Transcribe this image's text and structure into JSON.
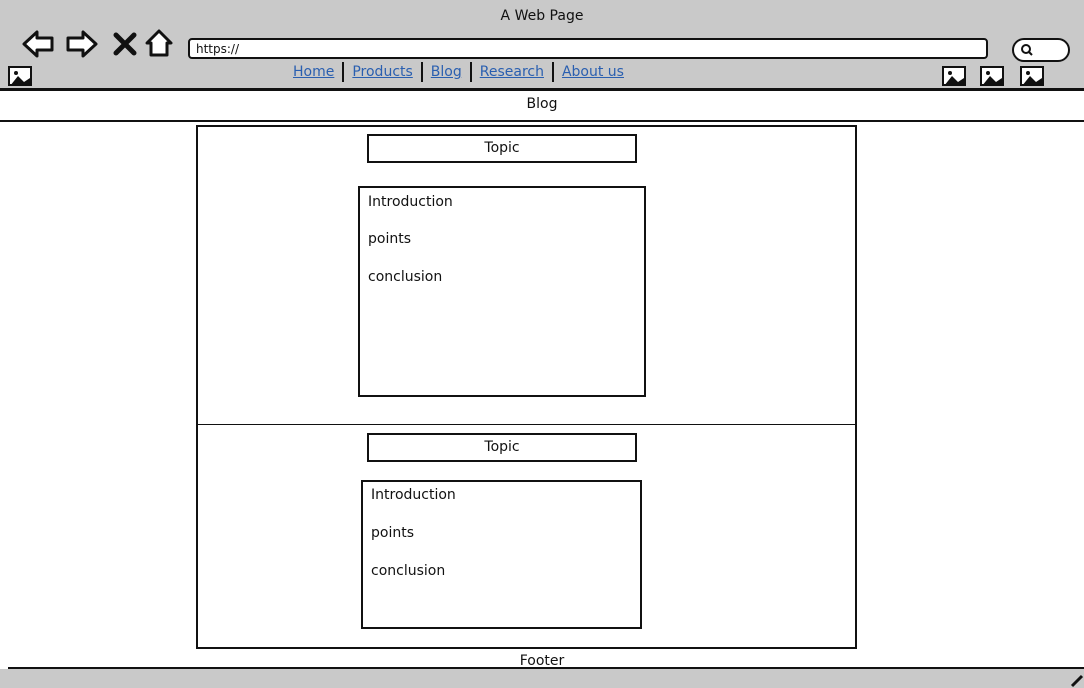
{
  "browser": {
    "title": "A Web Page",
    "url": "https://",
    "nav_links": [
      "Home",
      "Products",
      "Blog",
      "Research",
      "About us"
    ]
  },
  "page": {
    "section_title": "Blog",
    "posts": [
      {
        "topic": "Topic",
        "lines": [
          "Introduction",
          "points",
          "conclusion"
        ]
      },
      {
        "topic": "Topic",
        "lines": [
          "Introduction",
          "points",
          "conclusion"
        ]
      }
    ],
    "footer": "Footer"
  }
}
